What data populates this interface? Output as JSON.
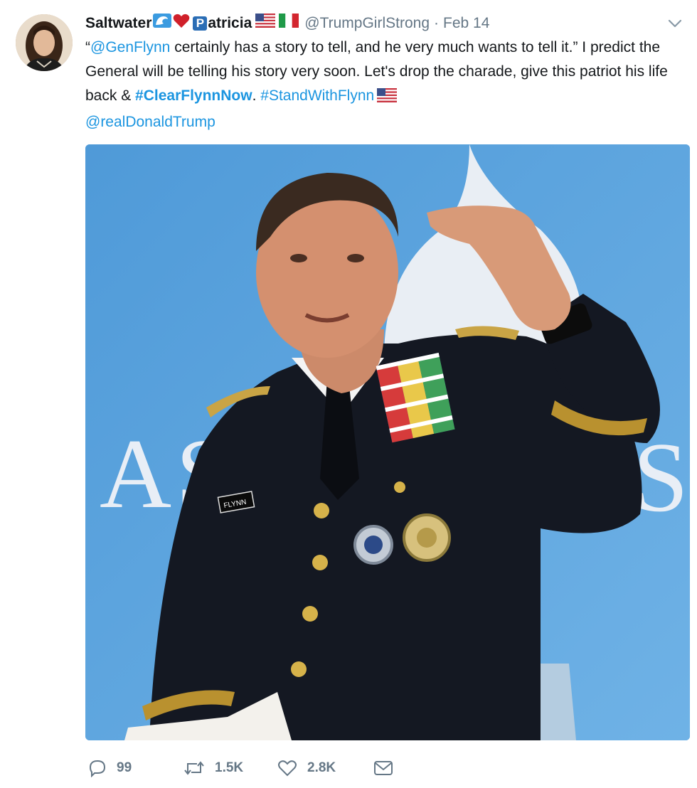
{
  "tweet": {
    "author_name": "Saltwater",
    "author_name_suffix": "atricia",
    "author_badge_letter": "P",
    "handle": "@TrumpGirlStrong",
    "separator": "·",
    "date": "Feb 14",
    "text": {
      "mention_1": "@GenFlynn",
      "part_1_open_quote": "“",
      "part_1": " certainly has a story to tell, and he very much wants to tell it.” I predict the General will be telling his story very soon. Let's drop the charade, give this patriot his life back & ",
      "hashtag_1": "#ClearFlynnNow",
      "part_2": ". ",
      "hashtag_2": "#StandWithFlynn",
      "mention_2": "@realDonaldTrump"
    },
    "media": {
      "backdrop_text_left": "AS",
      "backdrop_text_right": "ST",
      "name_tag": "FLYNN"
    },
    "actions": {
      "replies": "99",
      "retweets": "1.5K",
      "likes": "2.8K"
    }
  },
  "icons": {
    "wave": "wave-icon",
    "heart_emoji": "red-heart-icon",
    "flag_us": "us-flag-icon",
    "flag_it": "italy-flag-icon",
    "caret": "chevron-down-icon",
    "reply": "reply-icon",
    "retweet": "retweet-icon",
    "like": "heart-icon",
    "dm": "envelope-icon"
  },
  "colors": {
    "link": "#1b95e0",
    "secondary": "#657786",
    "text": "#14171a",
    "backdrop_blue": "#5ea5df"
  }
}
